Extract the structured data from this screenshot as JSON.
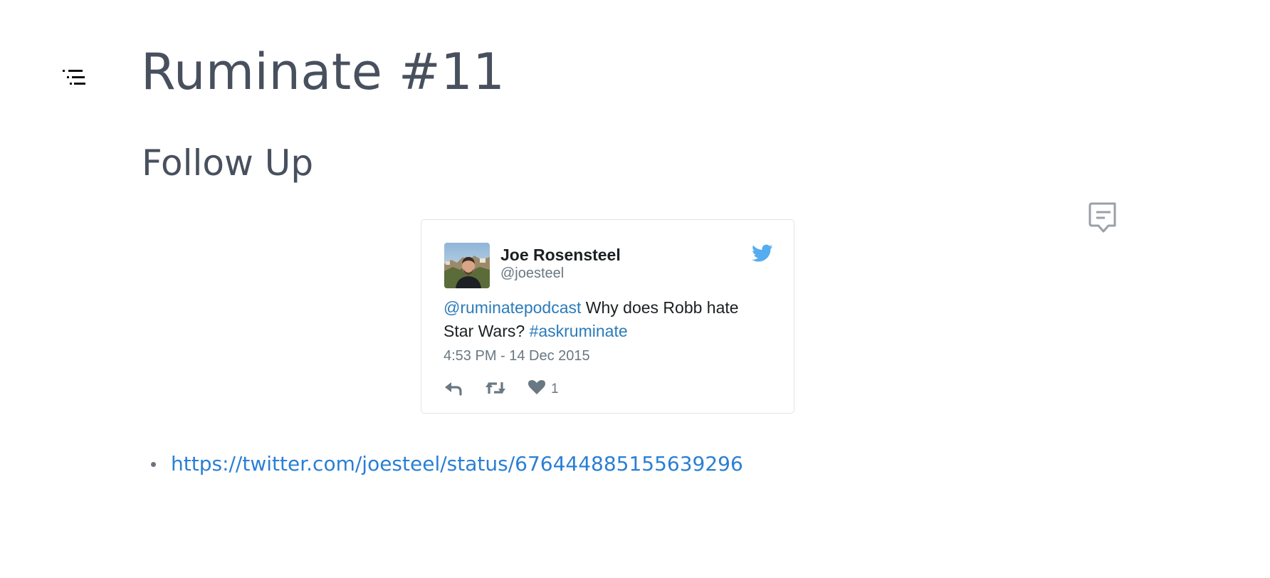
{
  "document": {
    "title": "Ruminate #11",
    "heading": "Follow Up",
    "links": [
      "https://twitter.com/joesteel/status/676444885155639296"
    ]
  },
  "tweet": {
    "author_name": "Joe Rosensteel",
    "author_handle": "@joesteel",
    "mention": "@ruminatepodcast",
    "body": " Why does Robb hate Star Wars? ",
    "hashtag": "#askruminate",
    "timestamp": "4:53 PM - 14 Dec 2015",
    "like_count": "1"
  },
  "colors": {
    "heading": "#48505e",
    "link": "#2a7fd4",
    "tweet_link": "#2b7bb9",
    "twitter_blue": "#55acee",
    "muted": "#697882"
  },
  "icons": {
    "toc": "table-of-contents-icon",
    "comment": "comment-icon",
    "twitter": "twitter-bird-icon",
    "reply": "reply-icon",
    "retweet": "retweet-icon",
    "like": "heart-icon"
  }
}
